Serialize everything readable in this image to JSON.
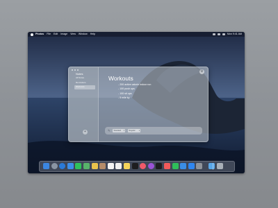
{
  "menubar": {
    "app_name": "Photos",
    "items": [
      "File",
      "Edit",
      "Image",
      "View",
      "Window",
      "Help"
    ],
    "clock": "Mon 9:41 AM"
  },
  "notes_app": {
    "sidebar": {
      "title": "Notes",
      "items": [
        {
          "label": "All Notes",
          "selected": false
        },
        {
          "label": "Reminders",
          "selected": false
        },
        {
          "label": "Workouts",
          "selected": true
        }
      ],
      "add_icon": "plus-icon"
    },
    "note": {
      "title": "Workouts",
      "items": [
        "200 active calorie indoor run",
        "100 push ups",
        "100 sit ups",
        "5 mile ky"
      ]
    },
    "bottom_bar": {
      "pen_icon": "pen-icon",
      "dropdown_1": "Standard",
      "dropdown_2": "Regular"
    },
    "settings_icon": "gear-icon"
  },
  "dock": {
    "apps": [
      {
        "name": "finder-icon",
        "color": "#3b86e0"
      },
      {
        "name": "launchpad-icon",
        "color": "#8a95a3"
      },
      {
        "name": "safari-icon",
        "color": "#2a7ad8"
      },
      {
        "name": "mail-icon",
        "color": "#3d8ee8"
      },
      {
        "name": "messages-icon",
        "color": "#2fc25a"
      },
      {
        "name": "maps-icon",
        "color": "#58b36a"
      },
      {
        "name": "photos-icon",
        "color": "#e9c34c"
      },
      {
        "name": "contacts-icon",
        "color": "#b58c6a"
      },
      {
        "name": "calendar-icon",
        "color": "#f4f4f4"
      },
      {
        "name": "reminders-icon",
        "color": "#f0f0f0"
      },
      {
        "name": "notes-icon",
        "color": "#f5d45a"
      },
      {
        "name": "tv-icon",
        "color": "#1d1d1f"
      },
      {
        "name": "music-icon",
        "color": "#f05a6a"
      },
      {
        "name": "podcasts-icon",
        "color": "#9a53d6"
      },
      {
        "name": "appletv-icon",
        "color": "#1d1d1f"
      },
      {
        "name": "news-icon",
        "color": "#f25a5a"
      },
      {
        "name": "numbers-icon",
        "color": "#2fbf5a"
      },
      {
        "name": "keynote-icon",
        "color": "#3a8ee6"
      },
      {
        "name": "appstore-icon",
        "color": "#2f86f0"
      },
      {
        "name": "settings-icon",
        "color": "#8e939a"
      },
      {
        "name": "folder-icon",
        "color": "#5aa7e8"
      },
      {
        "name": "trash-icon",
        "color": "#a9b0b8"
      }
    ]
  }
}
